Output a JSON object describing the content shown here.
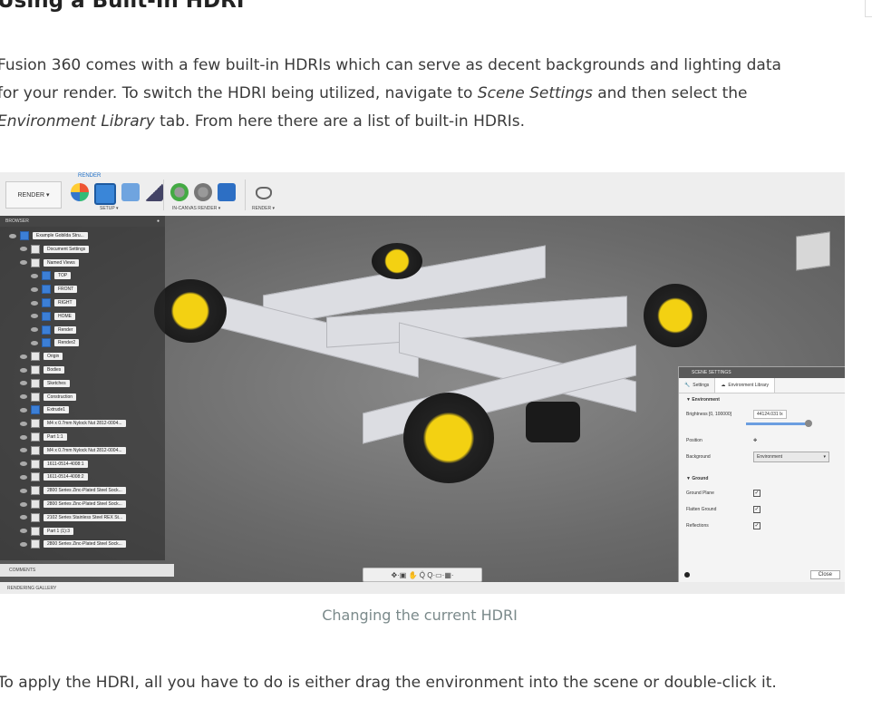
{
  "heading": "Using a Built-In HDRI",
  "paragraph1": {
    "line1": "Fusion 360 comes with a few built-in HDRIs which can serve as decent backgrounds and lighting data",
    "line2_pre": "for your render. To switch the HDRI being utilized, navigate to ",
    "line2_em": "Scene Settings",
    "line2_post": " and then select the",
    "line3_em": "Environment Library",
    "line3_post": " tab. From here there are a list of built-in HDRIs."
  },
  "figure": {
    "toolbar": {
      "render_menu": "RENDER ▾",
      "top_label": "RENDER",
      "setup_label": "SETUP ▾",
      "incanvas_label": "IN-CANVAS RENDER ▾",
      "render_label": "RENDER ▾"
    },
    "browser": {
      "title": "BROWSER",
      "items": [
        "Example Gobilda Stru...",
        "Document Settings",
        "Named Views",
        "TOP",
        "FRONT",
        "RIGHT",
        "HOME",
        "Render",
        "Render2",
        "Origin",
        "Bodies",
        "Sketches",
        "Construction",
        "Extrude1",
        "M4 x 0.7mm Nylock Nut 2812-0004...",
        "Part 1:1",
        "M4 x 0.7mm Nylock Nut 2812-0004...",
        "1611-0514-4008:1",
        "1611-0514-4008:2",
        "2800 Series Zinc-Plated Steel Sock...",
        "2800 Series Zinc-Plated Steel Sock...",
        "2102 Series Stainless Steel REX St...",
        "Part 1 (1):3",
        "2800 Series Zinc-Plated Steel Sock..."
      ],
      "comments": "COMMENTS",
      "gallery": "RENDERING GALLERY"
    },
    "scene_settings": {
      "title": "SCENE SETTINGS",
      "tab_settings": "Settings",
      "tab_library": "Environment Library",
      "section_environment": "▼ Environment",
      "brightness_label": "Brightness [0, 100000]",
      "brightness_value": "44124.031 lx",
      "position_label": "Position",
      "background_label": "Background",
      "background_value": "Environment",
      "section_ground": "▼ Ground",
      "ground_plane": "Ground Plane",
      "flatten_ground": "Flatten Ground",
      "reflections": "Reflections",
      "close": "Close"
    },
    "nav_bar": "✥·▣ ✋ Q̈ Q·▭·▦·"
  },
  "caption": "Changing the current HDRI",
  "paragraph2": "To apply the HDRI, all you have to do is either drag the environment into the scene or double-click it."
}
